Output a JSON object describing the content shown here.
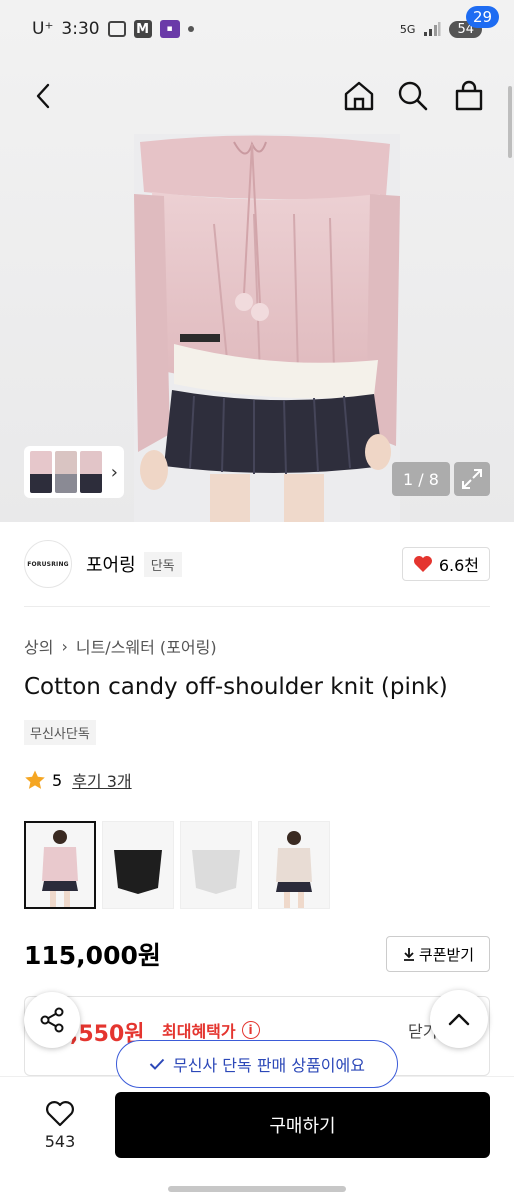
{
  "status_bar": {
    "carrier": "U⁺",
    "time": "3:30",
    "app_badge_text": "M",
    "network": "5G",
    "battery": "54"
  },
  "header": {
    "cart_count": "29"
  },
  "gallery": {
    "counter": "1 / 8"
  },
  "brand": {
    "logo_text": "FORUSRING",
    "name": "포어링",
    "exclusive_tag": "단독",
    "likes": "6.6천"
  },
  "breadcrumb": [
    "상의",
    "니트/스웨터 (포어링)"
  ],
  "product": {
    "title": "Cotton candy off-shoulder knit (pink)",
    "tag": "무신사단독",
    "rating": "5",
    "review_link": "후기 3개",
    "price": "115,000원"
  },
  "swatches": [
    {
      "color": "#e9c9cd",
      "skirt": "#2b2b3a"
    },
    {
      "color": "#1e1e1e",
      "skirt": "#f6f6f6"
    },
    {
      "color": "#dcdcdc",
      "skirt": "#f6f6f6"
    },
    {
      "color": "#e8dcd4",
      "skirt": "#2b2b3a"
    }
  ],
  "coupon": {
    "label": "쿠폰받기"
  },
  "benefit": {
    "price_partial": ",550원",
    "label": "최대혜택가",
    "close_partial": "닫기"
  },
  "toast": {
    "text": "무신사 단독 판매 상품이에요"
  },
  "bottom": {
    "wish_count": "543",
    "buy_label": "구매하기"
  },
  "colors": {
    "accent_blue": "#1e6cf2",
    "sale_red": "#e4352f",
    "toast_blue": "#2c48b8",
    "star": "#f5a623"
  }
}
